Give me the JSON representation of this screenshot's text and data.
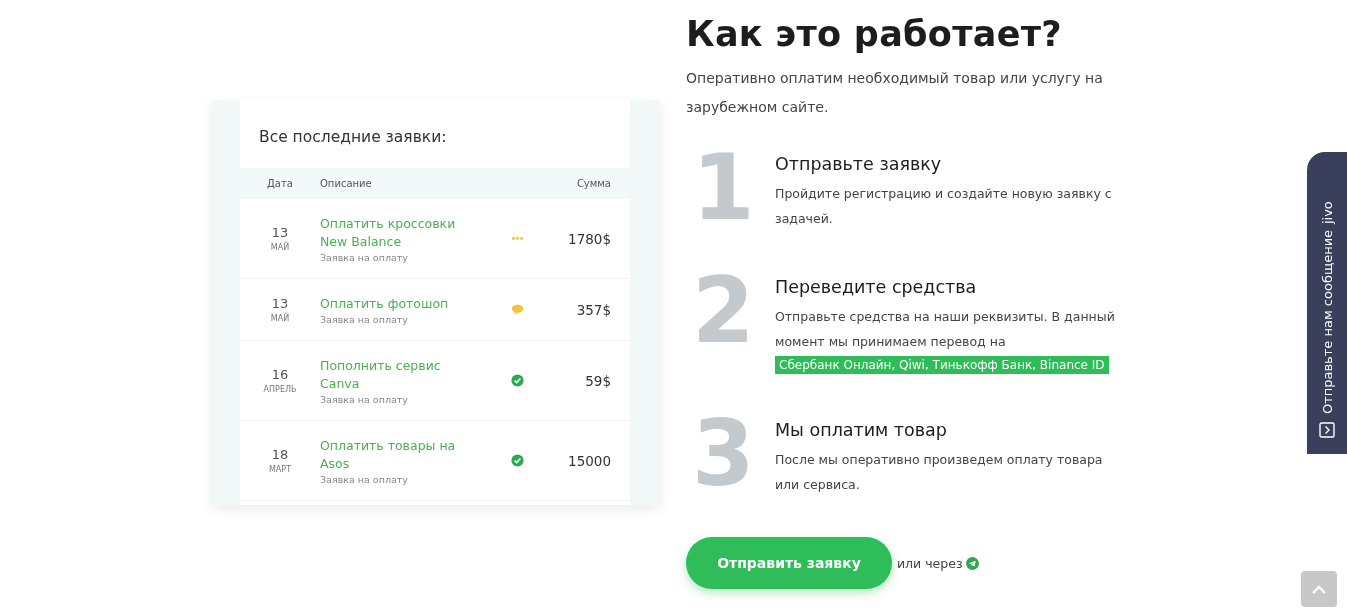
{
  "requests_card": {
    "title": "Все последние заявки:",
    "columns": [
      "Дата",
      "Описание",
      "Сумма"
    ],
    "rows": [
      {
        "day": "13",
        "month": "МАЙ",
        "title": "Оплатить кроссовки New Balance",
        "subtitle": "Заявка на оплату",
        "kind": "pending",
        "amount": "1780$"
      },
      {
        "day": "13",
        "month": "МАЙ",
        "title": "Оплатить фотошоп",
        "subtitle": "Заявка на оплату",
        "kind": "message",
        "amount": "357$"
      },
      {
        "day": "16",
        "month": "АПРЕЛЬ",
        "title": "Пополнить сервис Canva",
        "subtitle": "Заявка на оплату",
        "kind": "done",
        "amount": "59$"
      },
      {
        "day": "18",
        "month": "МАРТ",
        "title": "Оплатить товары на Asos",
        "subtitle": "Заявка на оплату",
        "kind": "done",
        "amount": "15000"
      }
    ]
  },
  "heading": "Как это работает?",
  "intro": "Оперативно оплатим необходимый товар или услугу на зарубежном сайте.",
  "steps": [
    {
      "number": "1",
      "title": "Отправьте заявку",
      "text": "Пройдите регистрацию и создайте новую заявку с задачей."
    },
    {
      "number": "2",
      "title": "Переведите средства",
      "text": "Отправьте средства на наши реквизиты. В данный момент мы принимаем перевод на",
      "highlight": "Сбербанк Онлайн, Qiwi, Тинькофф Банк, Binance ID"
    },
    {
      "number": "3",
      "title": "Мы оплатим товар",
      "text": "После мы оперативно произведем оплату товара или сервиса."
    }
  ],
  "cta": {
    "button": "Отправить заявку",
    "alt_text": "или через"
  },
  "chat_widget": {
    "label": "Отправьте нам сообщение",
    "brand": "jivo"
  }
}
